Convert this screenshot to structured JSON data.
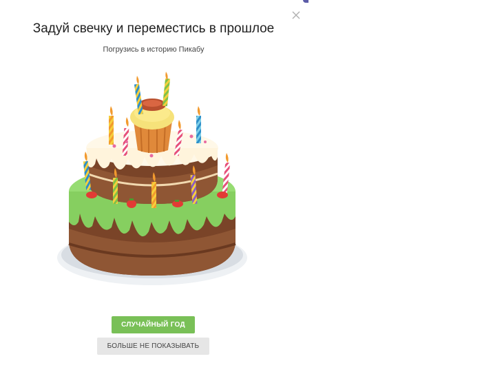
{
  "modal": {
    "title": "Задуй свечку и переместись в прошлое",
    "subtitle": "Погрузись в историю Пикабу",
    "close_icon": "close-icon",
    "image_icon": "birthday-cake-icon",
    "primary_button_label": "СЛУЧАЙНЫЙ ГОД",
    "secondary_button_label": "БОЛЬШЕ НЕ ПОКАЗЫВАТЬ"
  },
  "colors": {
    "primary_button": "#79c057",
    "secondary_button": "#e6e6e6",
    "frosting_green": "#8cd46a",
    "cake_brown": "#8a5030",
    "cream": "#fff6de"
  }
}
